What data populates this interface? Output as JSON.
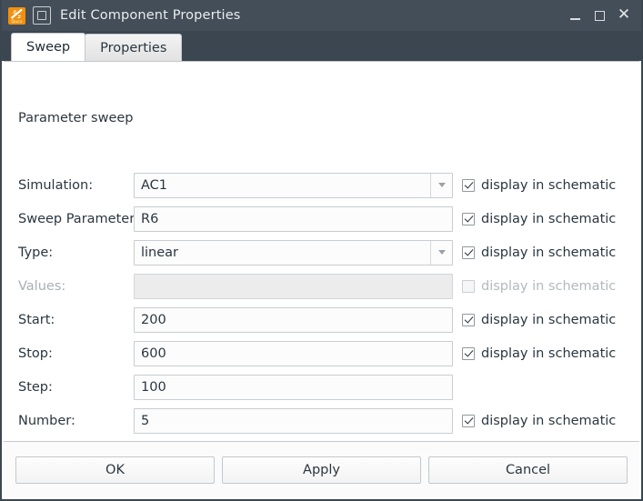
{
  "window": {
    "title": "Edit Component Properties",
    "app_icon": "qucs-logo-icon",
    "doc_icon": "document-icon",
    "brand": "Qucs",
    "controls": {
      "minimize": "minimize-icon",
      "maximize": "maximize-icon",
      "close": "close-icon"
    }
  },
  "tabs": [
    {
      "label": "Sweep",
      "active": true
    },
    {
      "label": "Properties",
      "active": false
    }
  ],
  "section": {
    "title": "Parameter sweep"
  },
  "checkbox_label": "display in schematic",
  "rows": [
    {
      "label": "Simulation:",
      "value": "AC1",
      "type": "combobox",
      "enabled": true,
      "checkbox": {
        "present": true,
        "checked": true,
        "enabled": true
      }
    },
    {
      "label": "Sweep Parameter:",
      "value": "R6",
      "type": "text",
      "enabled": true,
      "checkbox": {
        "present": true,
        "checked": true,
        "enabled": true
      }
    },
    {
      "label": "Type:",
      "value": "linear",
      "type": "combobox",
      "enabled": true,
      "checkbox": {
        "present": true,
        "checked": true,
        "enabled": true
      }
    },
    {
      "label": "Values:",
      "value": "",
      "type": "text",
      "enabled": false,
      "checkbox": {
        "present": true,
        "checked": false,
        "enabled": false
      }
    },
    {
      "label": "Start:",
      "value": "200",
      "type": "text",
      "enabled": true,
      "checkbox": {
        "present": true,
        "checked": true,
        "enabled": true
      }
    },
    {
      "label": "Stop:",
      "value": "600",
      "type": "text",
      "enabled": true,
      "checkbox": {
        "present": true,
        "checked": true,
        "enabled": true
      }
    },
    {
      "label": "Step:",
      "value": "100",
      "type": "text",
      "enabled": true,
      "checkbox": {
        "present": false,
        "checked": false,
        "enabled": false
      }
    },
    {
      "label": "Number:",
      "value": "5",
      "type": "text",
      "enabled": true,
      "checkbox": {
        "present": true,
        "checked": true,
        "enabled": true
      }
    }
  ],
  "footer_buttons": [
    {
      "label": "OK",
      "name": "ok-button"
    },
    {
      "label": "Apply",
      "name": "apply-button"
    },
    {
      "label": "Cancel",
      "name": "cancel-button"
    }
  ],
  "colors": {
    "titlebar": "#434e58",
    "window_border": "#3c4650",
    "accent_logo": "#f2900d",
    "text": "#2b3640",
    "disabled_text": "#a9b0b6",
    "field_bg": "#fcfcfc",
    "field_border": "#c8cdd2",
    "panel_bg": "#ffffff",
    "footer_bg": "#fbfbfb"
  }
}
